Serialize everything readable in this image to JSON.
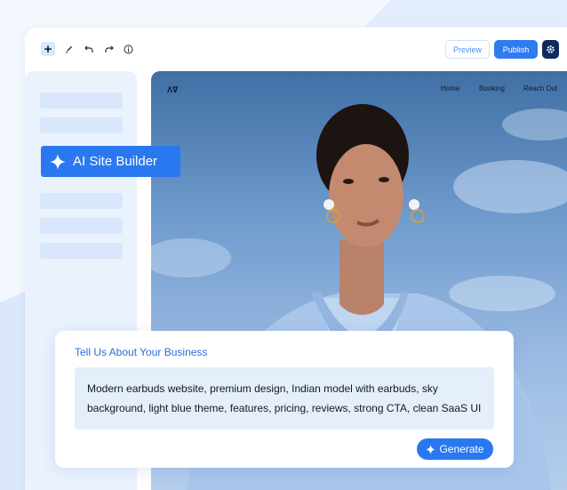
{
  "toolbar": {
    "preview_label": "Preview",
    "publish_label": "Publish",
    "icons": [
      "plus-icon",
      "pen-icon",
      "undo-icon",
      "redo-icon",
      "info-icon",
      "gear-icon"
    ]
  },
  "sidebar": {
    "badge_label": "AI Site Builder"
  },
  "site_preview": {
    "logo": "Ʌ∇",
    "nav": [
      "Home",
      "Booking",
      "Reach Out"
    ]
  },
  "prompt_card": {
    "title": "Tell Us About Your Business",
    "line1": "Modern earbuds website, premium design, Indian model with earbuds, sky",
    "line2": "background, light blue theme, features, pricing, reviews, strong CTA, clean SaaS UI",
    "generate_label": "Generate"
  },
  "colors": {
    "accent": "#2a78f0",
    "dark_accent": "#0f2a5c",
    "page_bg": "#f3f8fe",
    "sidebar_bg": "#eaf2fd",
    "input_bg": "#e5eefb"
  }
}
